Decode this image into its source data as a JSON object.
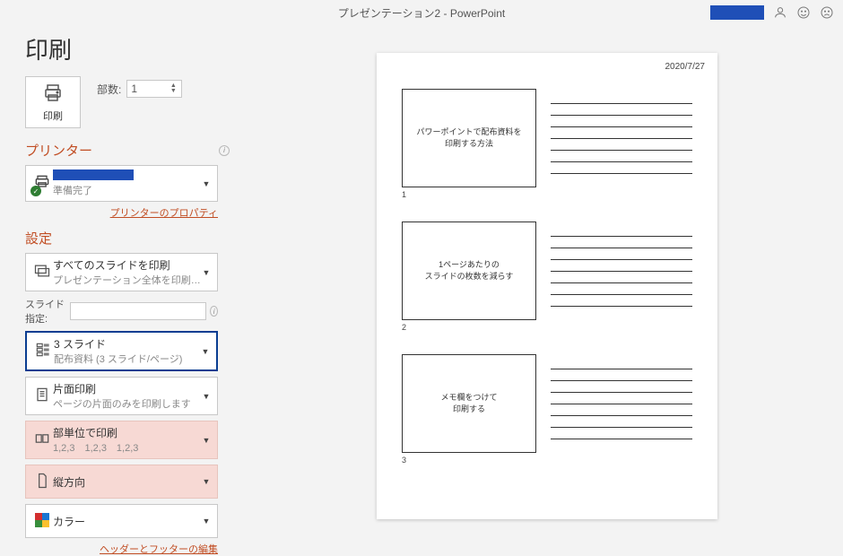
{
  "titlebar": {
    "document_title": "プレゼンテーション2  -  PowerPoint"
  },
  "page_title": "印刷",
  "print_button_label": "印刷",
  "copies": {
    "label": "部数:",
    "value": "1"
  },
  "printer": {
    "header": "プリンター",
    "status": "準備完了",
    "properties_link": "プリンターのプロパティ"
  },
  "settings": {
    "header": "設定",
    "range": {
      "title": "すべてのスライドを印刷",
      "subtitle": "プレゼンテーション全体を印刷…"
    },
    "slide_spec_label": "スライド指定:",
    "layout": {
      "title": "3 スライド",
      "subtitle": "配布資料 (3 スライド/ページ)"
    },
    "sides": {
      "title": "片面印刷",
      "subtitle": "ページの片面のみを印刷します"
    },
    "collate": {
      "title": "部単位で印刷",
      "subtitle": "1,2,3　1,2,3　1,2,3"
    },
    "orientation": {
      "title": "縦方向"
    },
    "color": {
      "title": "カラー"
    },
    "hf_link": "ヘッダーとフッターの編集"
  },
  "preview": {
    "date": "2020/7/27",
    "slides": [
      {
        "num": "1",
        "caption": "パワーポイントで配布資料を\n印刷する方法"
      },
      {
        "num": "2",
        "caption": "1ページあたりの\nスライドの枚数を減らす"
      },
      {
        "num": "3",
        "caption": "メモ欄をつけて\n印刷する"
      }
    ]
  }
}
